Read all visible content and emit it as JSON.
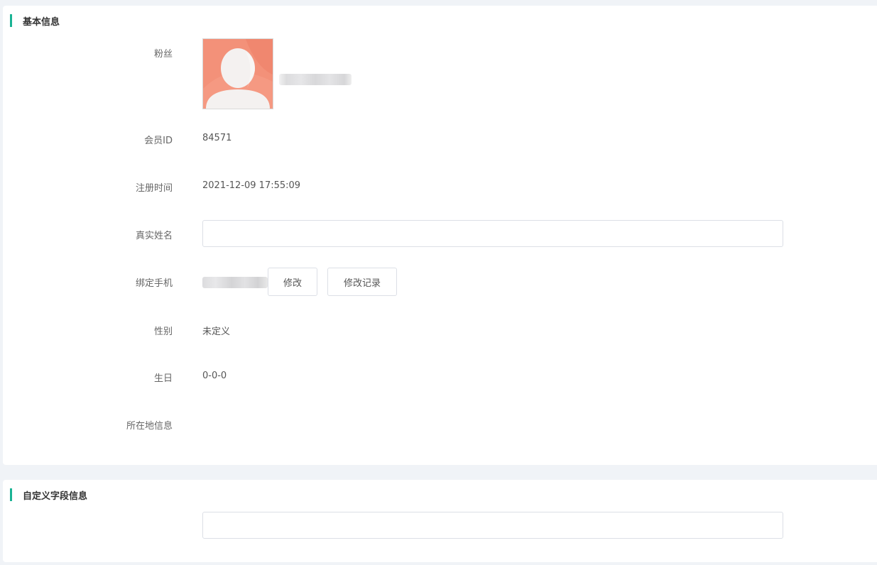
{
  "sections": {
    "basic": {
      "title": "基本信息"
    },
    "custom": {
      "title": "自定义字段信息"
    }
  },
  "fields": {
    "fan": {
      "label": "粉丝"
    },
    "member_id": {
      "label": "会员ID",
      "value": "84571"
    },
    "register_time": {
      "label": "注册时间",
      "value": "2021-12-09 17:55:09"
    },
    "real_name": {
      "label": "真实姓名",
      "value": ""
    },
    "phone": {
      "label": "绑定手机",
      "modify_label": "修改",
      "history_label": "修改记录"
    },
    "gender": {
      "label": "性别",
      "value": "未定义"
    },
    "birthday": {
      "label": "生日",
      "value": "0-0-0"
    },
    "location": {
      "label": "所在地信息",
      "value": ""
    }
  },
  "custom_field": {
    "value": ""
  },
  "colors": {
    "accent": "#1ab394",
    "avatar_bg": "#f39179",
    "page_bg": "#f0f3f7"
  },
  "icons": {
    "avatar": "default-user-avatar-icon"
  }
}
